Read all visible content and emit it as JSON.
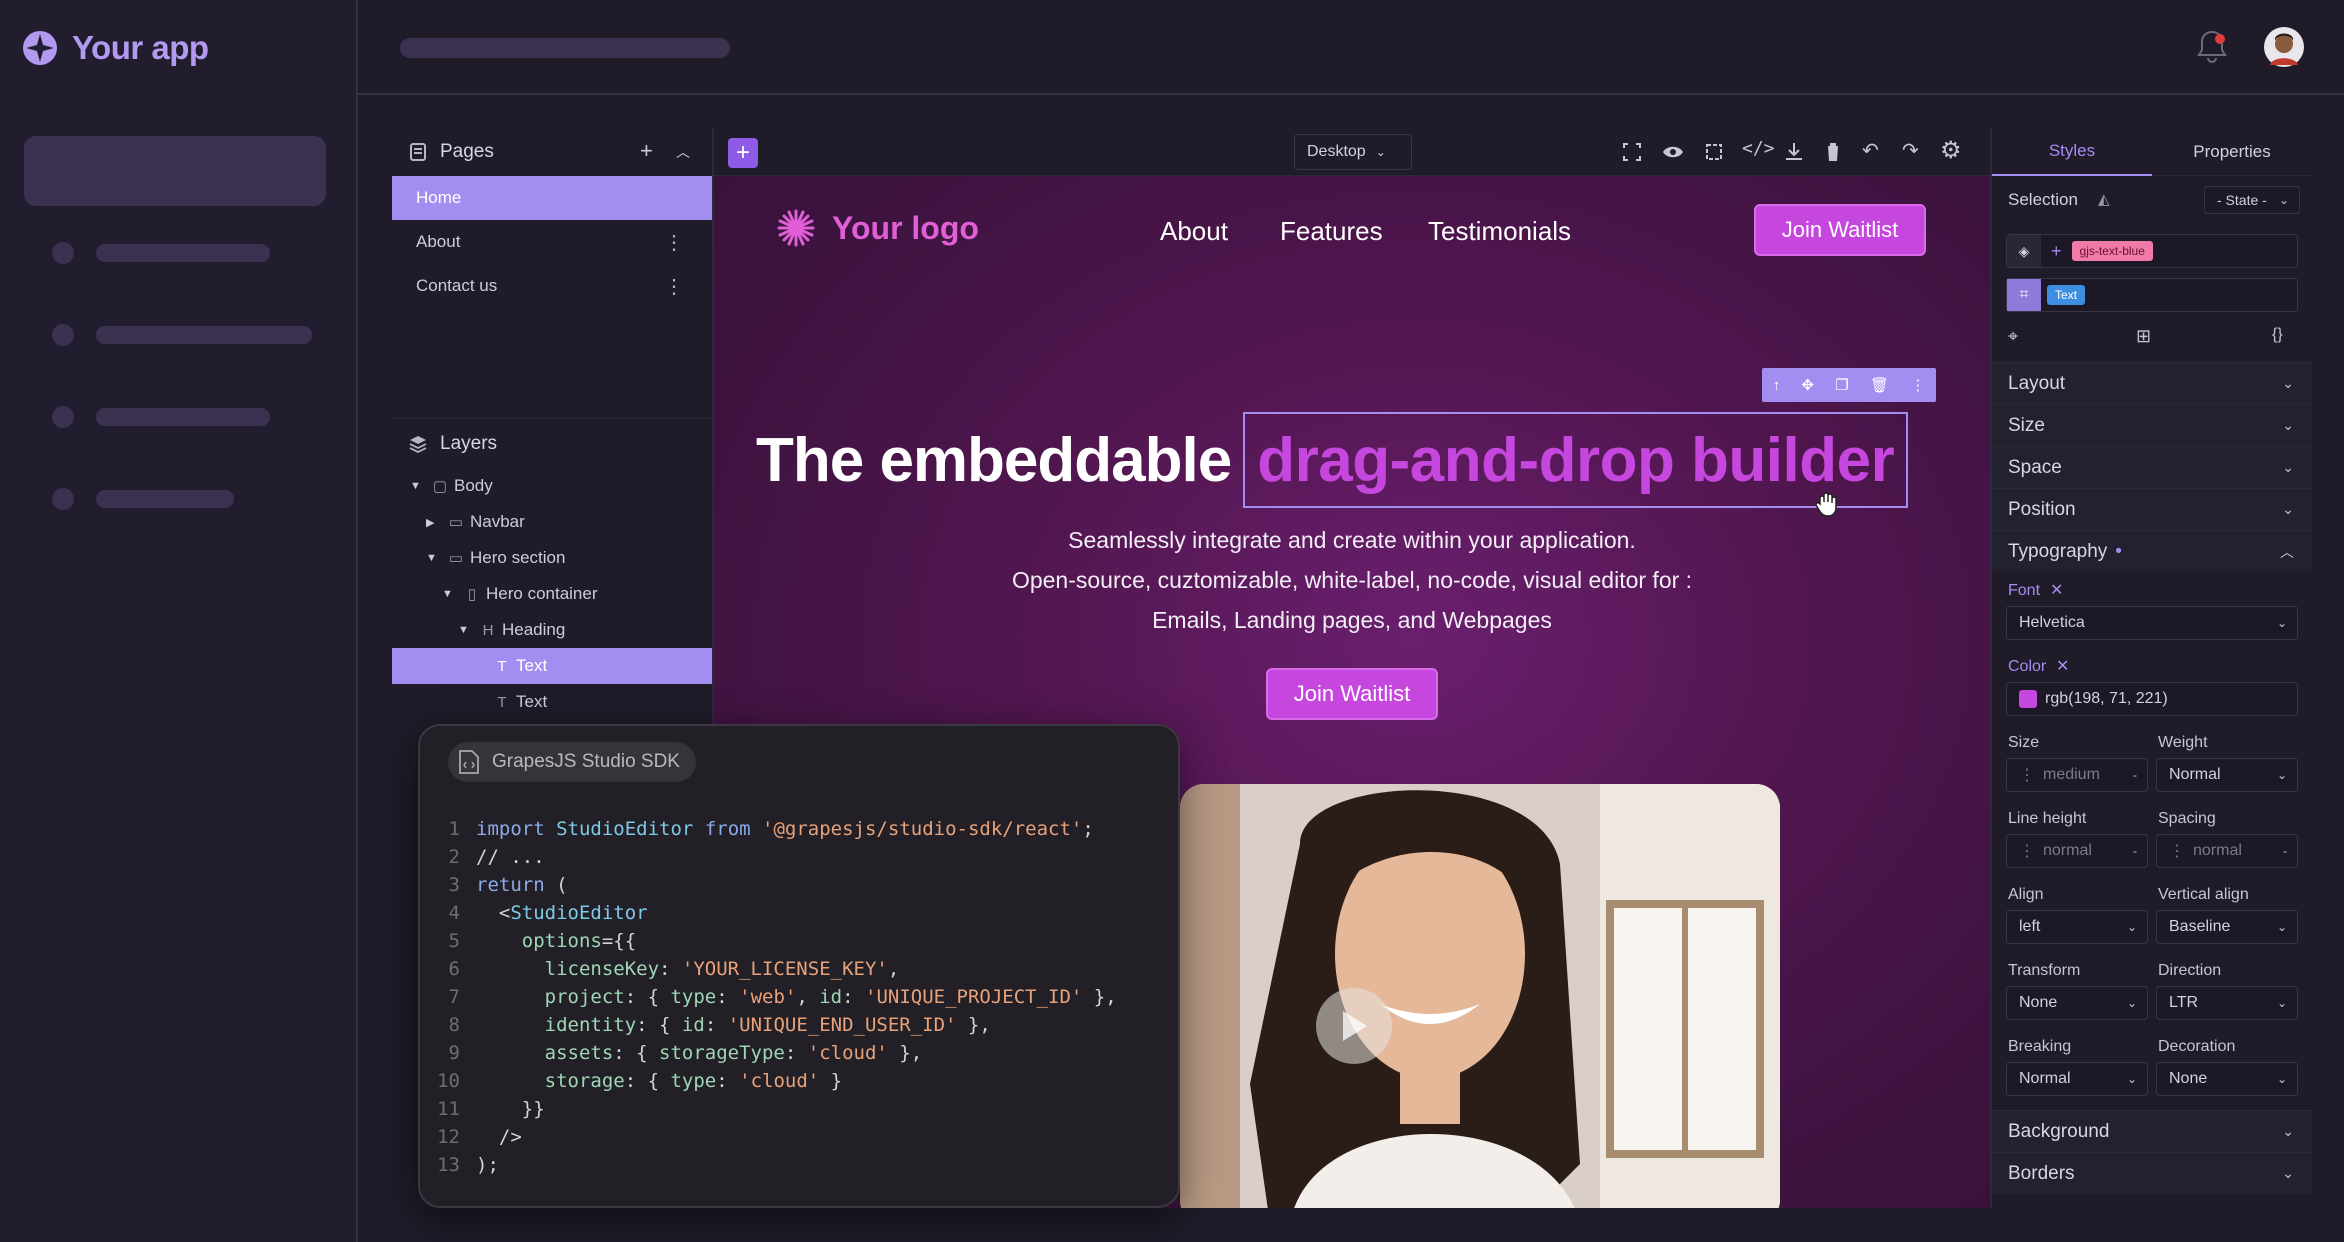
{
  "app": {
    "title": "Your app",
    "avatar_alt": "user avatar"
  },
  "pages_panel": {
    "title": "Pages",
    "pages": [
      {
        "label": "Home"
      },
      {
        "label": "About"
      },
      {
        "label": "Contact us"
      }
    ]
  },
  "layers_panel": {
    "title": "Layers",
    "items": [
      {
        "label": "Body"
      },
      {
        "label": "Navbar"
      },
      {
        "label": "Hero section"
      },
      {
        "label": "Hero container"
      },
      {
        "label": "Heading"
      },
      {
        "label": "Text"
      },
      {
        "label": "Text"
      }
    ]
  },
  "toolbar": {
    "device": "Desktop"
  },
  "site": {
    "logo": "Your logo",
    "nav": [
      "About",
      "Features",
      "Testimonials"
    ],
    "cta": "Join Waitlist",
    "heading_plain": "The embeddable",
    "heading_highlight": "drag-and-drop builder",
    "sub1": "Seamlessly integrate and create within your application.",
    "sub2": "Open-source, cuztomizable, white-label, no-code, visual editor for :",
    "sub3": "Emails, Landing pages, and Webpages",
    "cta2": "Join Waitlist"
  },
  "code_card": {
    "title": "GrapesJS Studio SDK",
    "lines": [
      "1",
      "2",
      "3",
      "4",
      "5",
      "6",
      "7",
      "8",
      "9",
      "10",
      "11",
      "12",
      "13"
    ]
  },
  "right_panel": {
    "tabs": [
      "Styles",
      "Properties"
    ],
    "selection_label": "Selection",
    "state": "- State -",
    "class_tag": "gjs-text-blue",
    "component_tag": "Text",
    "sections": [
      "Layout",
      "Size",
      "Space",
      "Position",
      "Typography",
      "Background",
      "Borders"
    ],
    "font_label": "Font",
    "font_value": "Helvetica",
    "color_label": "Color",
    "color_value": "rgb(198, 71, 221)",
    "color_swatch": "#c647dd",
    "size_label": "Size",
    "size_value": "medium",
    "weight_label": "Weight",
    "weight_value": "Normal",
    "lineheight_label": "Line height",
    "lineheight_value": "normal",
    "spacing_label": "Spacing",
    "spacing_value": "normal",
    "align_label": "Align",
    "align_value": "left",
    "valign_label": "Vertical align",
    "valign_value": "Baseline",
    "transform_label": "Transform",
    "transform_value": "None",
    "direction_label": "Direction",
    "direction_value": "LTR",
    "breaking_label": "Breaking",
    "breaking_value": "Normal",
    "decoration_label": "Decoration",
    "decoration_value": "None"
  },
  "colors": {
    "accent": "#a48df0",
    "pink": "#c647dd",
    "brand": "#b39af0"
  }
}
